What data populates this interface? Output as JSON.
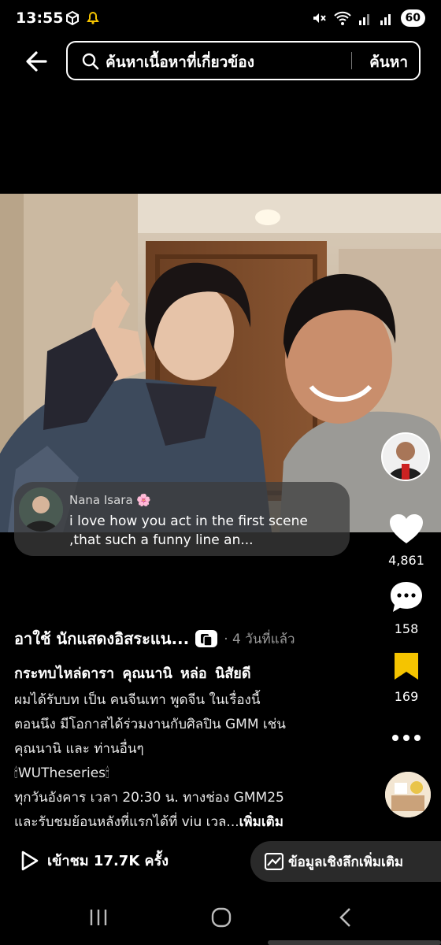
{
  "status": {
    "time": "13:55",
    "battery": "60"
  },
  "search": {
    "query": "ค้นหาเนื้อหาที่เกี่ยวข้อง",
    "button": "ค้นหา"
  },
  "comment": {
    "author": "Nana Isara 🌸",
    "text": "i love how you act in the first scene ,that such a funny line an..."
  },
  "actions": {
    "likes": "4,861",
    "comments": "158",
    "saves": "169"
  },
  "post": {
    "title": "อาใช้ นักแสดงอิสระแน...",
    "time_ago": "· 4 วันที่แล้ว",
    "tags": "กระทบไหล่ดารา คุณนานิ หล่อ นิสัยดี",
    "desc_lines": [
      "ผมได้รับบท เป็น คนจีนเทา พูดจีน ในเรื่องนี้",
      "ตอนนึง มีโอกาสได้ร่วมงานกับศิลปิน GMM เช่น",
      "คุณนานิ และ ท่านอื่นๆ",
      "🕯WUTheseries🕯",
      "ทุกวันอังคาร เวลา 20:30 น. ทางช่อง GMM25",
      "และรับชมย้อนหลังที่แรกได้ที่ viu เวล..."
    ],
    "more": "เพิ่มเติม"
  },
  "footer": {
    "views": "เข้าชม 17.7K ครั้ง",
    "insights": "ข้อมูลเชิงลึกเพิ่มเติม"
  },
  "icons": [
    "back-arrow-icon",
    "search-icon",
    "heart-icon",
    "comment-icon",
    "bookmark-icon",
    "more-icon",
    "play-icon",
    "chart-icon"
  ],
  "colors": {
    "bookmark": "#f5c400",
    "background": "#000000"
  }
}
